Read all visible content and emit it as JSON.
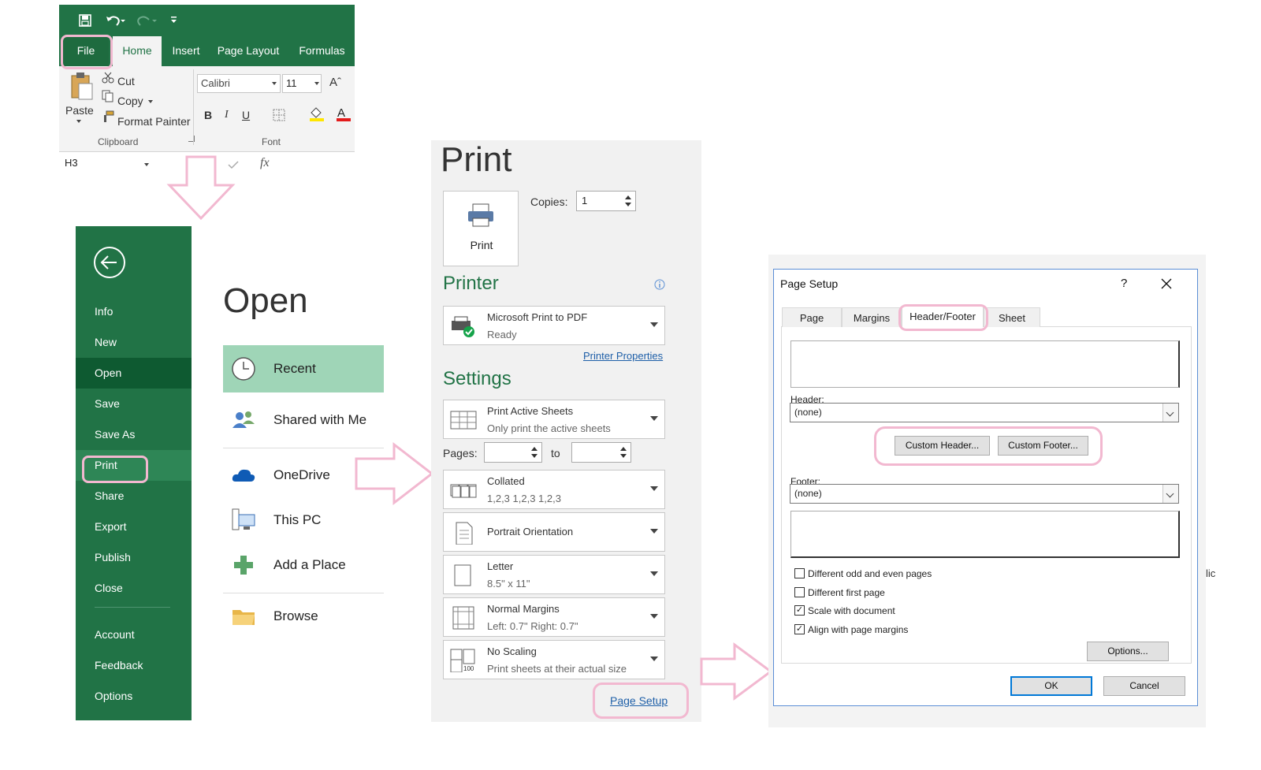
{
  "ribbon": {
    "tabs": [
      "File",
      "Home",
      "Insert",
      "Page Layout",
      "Formulas"
    ],
    "clipboard": {
      "paste": "Paste",
      "cut": "Cut",
      "copy": "Copy",
      "format_painter": "Format Painter",
      "group_label": "Clipboard"
    },
    "font": {
      "name": "Calibri",
      "size": "11",
      "bold": "B",
      "italic": "I",
      "underline": "U",
      "group_label": "Font"
    },
    "name_box": "H3",
    "fx": "fx"
  },
  "backstage": {
    "nav": [
      "Info",
      "New",
      "Open",
      "Save",
      "Save As",
      "Print",
      "Share",
      "Export",
      "Publish",
      "Close",
      "Account",
      "Feedback",
      "Options"
    ],
    "title": "Open",
    "locations": [
      "Recent",
      "Shared with Me",
      "OneDrive",
      "This PC",
      "Add a Place",
      "Browse"
    ]
  },
  "print": {
    "title": "Print",
    "print_button": "Print",
    "copies_label": "Copies:",
    "copies_value": "1",
    "printer_heading": "Printer",
    "printer_name": "Microsoft Print to PDF",
    "printer_status": "Ready",
    "printer_properties": "Printer Properties",
    "settings_heading": "Settings",
    "active_sheets": {
      "line1": "Print Active Sheets",
      "line2": "Only print the active sheets"
    },
    "pages_label": "Pages:",
    "to_label": "to",
    "collated": {
      "line1": "Collated",
      "line2": "1,2,3    1,2,3    1,2,3"
    },
    "orientation": "Portrait Orientation",
    "paper": {
      "line1": "Letter",
      "line2": "8.5\" x 11\""
    },
    "margins": {
      "line1": "Normal Margins",
      "line2": "Left:  0.7\"    Right:  0.7\""
    },
    "scaling": {
      "line1": "No Scaling",
      "line2": "Print sheets at their actual size"
    },
    "page_setup_link": "Page Setup"
  },
  "page_setup": {
    "title": "Page Setup",
    "help": "?",
    "tabs": [
      "Page",
      "Margins",
      "Header/Footer",
      "Sheet"
    ],
    "header_label": "Header:",
    "header_value": "(none)",
    "custom_header": "Custom Header...",
    "custom_footer": "Custom Footer...",
    "footer_label": "Footer:",
    "footer_value": "(none)",
    "options": [
      {
        "label": "Different odd and even pages",
        "checked": false
      },
      {
        "label": "Different first page",
        "checked": false
      },
      {
        "label": "Scale with document",
        "checked": true
      },
      {
        "label": "Align with page margins",
        "checked": true
      }
    ],
    "options_button": "Options...",
    "ok": "OK",
    "cancel": "Cancel",
    "edge_text": "lic"
  },
  "colors": {
    "excel_green": "#217346",
    "highlight_pink": "#f2b8d0",
    "link_blue": "#1e5fa8"
  }
}
